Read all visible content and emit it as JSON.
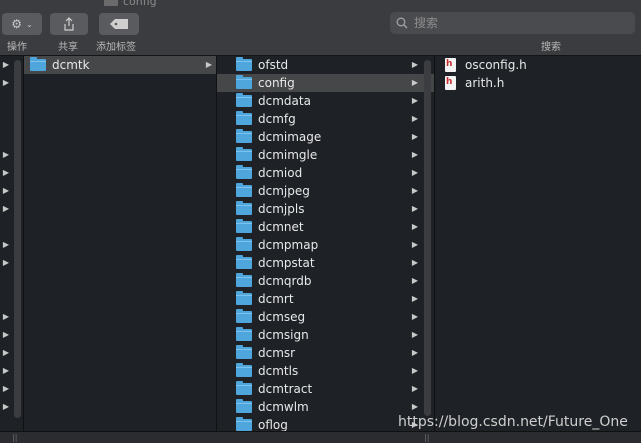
{
  "window": {
    "title": "config"
  },
  "toolbar": {
    "action_label": "操作",
    "share_label": "共享",
    "tags_label": "添加标签",
    "search_placeholder": "搜索",
    "search_label": "搜索"
  },
  "column1": {
    "items": [
      {
        "name": "dcmtk",
        "type": "folder",
        "selected": true
      }
    ]
  },
  "column2": {
    "items": [
      {
        "name": "ofstd"
      },
      {
        "name": "config",
        "selected": true
      },
      {
        "name": "dcmdata"
      },
      {
        "name": "dcmfg"
      },
      {
        "name": "dcmimage"
      },
      {
        "name": "dcmimgle"
      },
      {
        "name": "dcmiod"
      },
      {
        "name": "dcmjpeg"
      },
      {
        "name": "dcmjpls"
      },
      {
        "name": "dcmnet"
      },
      {
        "name": "dcmpmap"
      },
      {
        "name": "dcmpstat"
      },
      {
        "name": "dcmqrdb"
      },
      {
        "name": "dcmrt"
      },
      {
        "name": "dcmseg"
      },
      {
        "name": "dcmsign"
      },
      {
        "name": "dcmsr"
      },
      {
        "name": "dcmtls"
      },
      {
        "name": "dcmtract"
      },
      {
        "name": "dcmwlm"
      },
      {
        "name": "oflog"
      }
    ]
  },
  "column3": {
    "items": [
      {
        "name": "osconfig.h"
      },
      {
        "name": "arith.h"
      }
    ]
  },
  "file_icon_letter": "h",
  "watermark": "https://blog.csdn.net/Future_One",
  "colors": {
    "folder": "#4ea6dc",
    "selection": "#464749",
    "background": "#1e2227"
  }
}
